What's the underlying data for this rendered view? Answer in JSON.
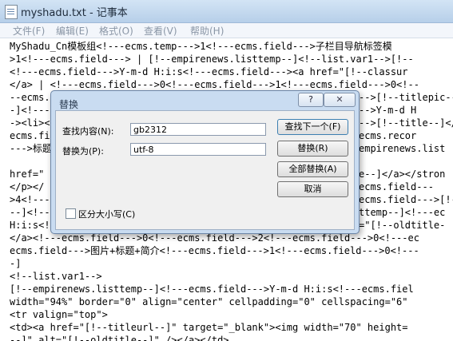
{
  "window": {
    "title": "myshadu.txt - 记事本",
    "menu": [
      "文件(F)",
      "编辑(E)",
      "格式(O)",
      "查看(V)",
      "帮助(H)"
    ]
  },
  "editor": {
    "lines": [
      "MyShadu_Cn模板组<!---ecms.temp--->1<!---ecms.field--->子栏目导航标签模",
      ">1<!---ecms.field---> | [!--empirenews.listtemp--]<!--list.var1-->[!--",
      "<!---ecms.field--->Y-m-d H:i:s<!---ecms.field---><a href=\"[!--classur",
      "</a> | <!---ecms.field--->0<!---ecms.field--->1<!---ecms.field--->0<!--",
      "--ecms.field--->Y-m-d H:i:s<!---ecms.field--->",
      "-]<!---ecms.field--->",
      "-><li><a href=\"[!--titleurl--]\">",
      "ecms.field--->",
      "--->标题",
      "href=\"",
      "</p></",
      ">4<!---ecms.field---",
      "--]<!---ecms.field--->",
      "H:i:s<!---ecms.field--->",
      "</a><!---ecms.field--->0<!---ecms.field--->2<!---ecms.field--->0<!---ec",
      "ecms.field--->图片+标题+简介<!---ecms.field--->1<!---ecms.field--->0<!---",
      "-]",
      "<!--list.var1-->",
      "[!--empirenews.listtemp--]<!---ecms.field--->Y-m-d H:i:s<!---ecms.fiel",
      "width=\"94%\" border=\"0\" align=\"center\" cellpadding=\"0\" cellspacing=\"6\"",
      "<tr valign=\"top\">",
      "<td><a href=\"[!--titleurl--]\" target=\"_blank\"><img width=\"70\" height=",
      "--]\" alt=\"[!--oldtitle--]\" /></a></td>"
    ],
    "right_fragments": [
      "-->[!--titlepic--]",
      "-->Y-m-d H",
      "-->[!--title--]</",
      "ecms.recor",
      "empirenews.list",
      "e--]</a></stron",
      "ecms.field---",
      "ecms.field--->[!-",
      "ttemp--]<!---ec",
      "=\"[!--oldtitle-"
    ]
  },
  "dialog": {
    "title": "替换",
    "help": "?",
    "close": "✕",
    "find_label": "查找内容(N):",
    "find_value": "gb2312",
    "replace_label": "替换为(P):",
    "replace_value": "utf-8",
    "find_next": "查找下一个(F)",
    "replace": "替换(R)",
    "replace_all": "全部替换(A)",
    "cancel": "取消",
    "match_case": "区分大小写(C)"
  }
}
